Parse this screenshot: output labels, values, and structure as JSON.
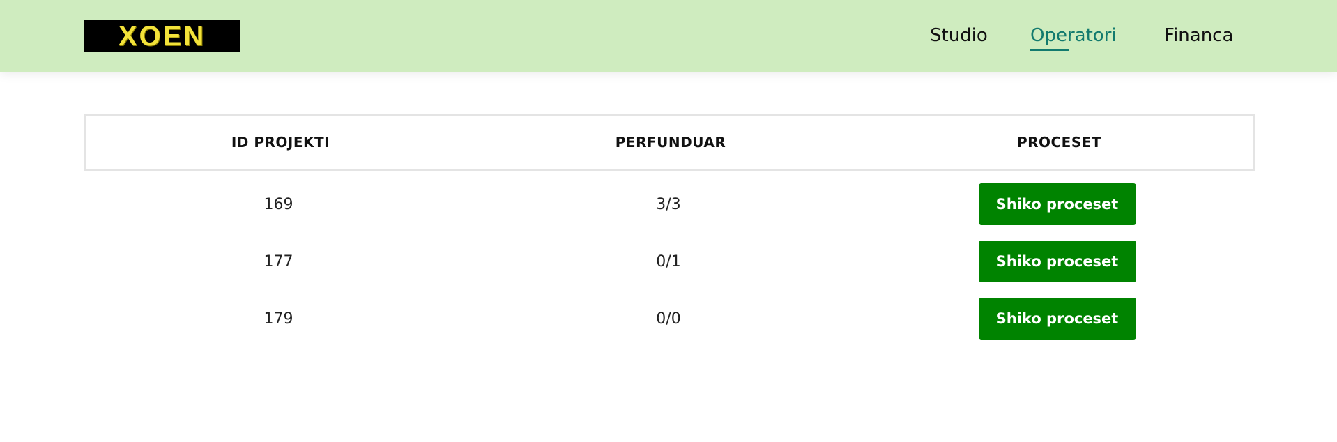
{
  "header": {
    "logo_text": "XOEN",
    "nav": [
      {
        "label": "Studio",
        "active": false
      },
      {
        "label": "Operatori",
        "active": true
      },
      {
        "label": "Financa",
        "active": false
      }
    ]
  },
  "table": {
    "columns": [
      "ID PROJEKTI",
      "PERFUNDUAR",
      "PROCESET"
    ],
    "rows": [
      {
        "id": "169",
        "done": "3/3",
        "action": "Shiko proceset"
      },
      {
        "id": "177",
        "done": "0/1",
        "action": "Shiko proceset"
      },
      {
        "id": "179",
        "done": "0/0",
        "action": "Shiko proceset"
      }
    ]
  },
  "colors": {
    "header_bg": "#cfecbf",
    "active_link": "#127a6e",
    "button_bg": "#008300",
    "logo_text": "#f3e23a"
  }
}
